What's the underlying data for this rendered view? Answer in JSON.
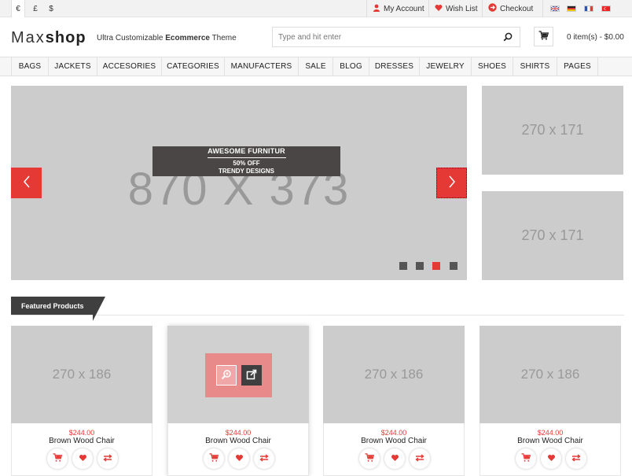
{
  "topbar": {
    "currencies": [
      "€",
      "£",
      "$"
    ],
    "links": {
      "account": "My Account",
      "wishlist": "Wish List",
      "checkout": "Checkout"
    }
  },
  "header": {
    "logo_a": "Max",
    "logo_b": "shop",
    "tagline_pre": "Ultra Customizable",
    "tagline_bold": "Ecommerce",
    "tagline_post": "Theme",
    "search_placeholder": "Type and hit enter",
    "cart_summary": "0 item(s) - $0.00"
  },
  "nav": [
    "BAGS",
    "JACKETS",
    "ACCESORIES",
    "CATEGORIES",
    "MANUFACTERS",
    "SALE",
    "BLOG",
    "DRESSES",
    "JEWELRY",
    "SHOES",
    "SHIRTS",
    "PAGES"
  ],
  "slider": {
    "placeholder": "870 X 373",
    "caption_line1": "AWESOME FURNITUR",
    "caption_line2": "50% OFF",
    "caption_line3": "TRENDY DESIGNS",
    "active_slide": 3,
    "slide_count": 4
  },
  "side_banners": [
    "270 x 171",
    "270 x 171"
  ],
  "featured": {
    "title": "Featured Products",
    "products": [
      {
        "image": "270 x 186",
        "price": "$244.00",
        "name": "Brown Wood Chair"
      },
      {
        "image": "",
        "price": "$244.00",
        "name": "Brown Wood Chair"
      },
      {
        "image": "270 x 186",
        "price": "$244.00",
        "name": "Brown Wood Chair"
      },
      {
        "image": "270 x 186",
        "price": "$244.00",
        "name": "Brown Wood Chair"
      }
    ]
  },
  "colors": {
    "accent": "#e53935",
    "dark": "#3f3f3f",
    "placeholder": "#cccccc"
  },
  "icons": {
    "account": "user-icon",
    "wishlist": "heart-icon",
    "checkout": "checkout-arrow-icon",
    "search": "search-icon",
    "cart": "cart-icon",
    "prev": "chevron-left-icon",
    "next": "chevron-right-icon",
    "zoom": "zoom-icon",
    "link": "external-link-icon",
    "compare": "compare-icon"
  }
}
